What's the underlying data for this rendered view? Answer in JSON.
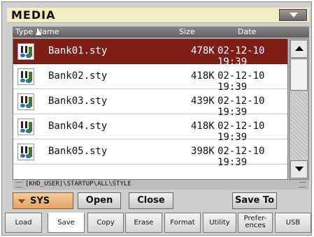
{
  "window": {
    "title": "MEDIA"
  },
  "header": {
    "type": "Type ▲",
    "name": "Name",
    "size": "Size",
    "date": "Date"
  },
  "files": [
    {
      "name": "Bank01.sty",
      "size": "478K",
      "date": "02-12-10 19:39",
      "selected": true
    },
    {
      "name": "Bank02.sty",
      "size": "418K",
      "date": "02-12-10 19:39",
      "selected": false
    },
    {
      "name": "Bank03.sty",
      "size": "439K",
      "date": "02-12-10 19:39",
      "selected": false
    },
    {
      "name": "Bank04.sty",
      "size": "418K",
      "date": "02-12-10 19:39",
      "selected": false
    },
    {
      "name": "Bank05.sty",
      "size": "398K",
      "date": "02-12-10 19:39",
      "selected": false
    }
  ],
  "path": "[KHD_USER]\\STARTUP\\ALL\\STYLE",
  "device": {
    "label": "SYS"
  },
  "buttons": {
    "open": "Open",
    "close": "Close",
    "save_to": "Save To"
  },
  "tabs": [
    "Load",
    "Save",
    "Copy",
    "Erase",
    "Format",
    "Utility",
    "Prefer-\nences",
    "USB"
  ],
  "active_tab": "Save",
  "colors": {
    "selected_row": "#7b1f18",
    "title_bar": "#f1eec2",
    "device_button": "#e3a566"
  },
  "icons": {
    "file_icon": "style-file-icon"
  }
}
